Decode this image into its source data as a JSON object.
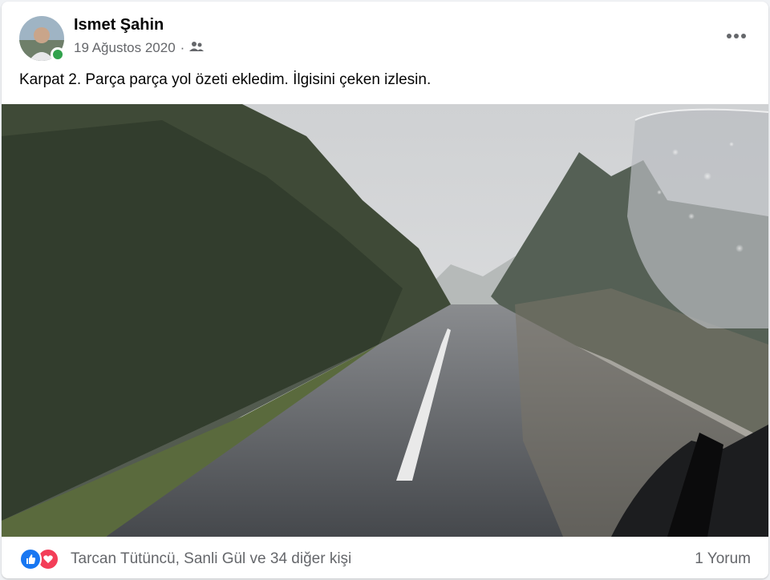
{
  "post": {
    "author": "Ismet Şahin",
    "date": "19 Ağustos 2020",
    "separator": "·",
    "audience_icon": "friends-icon",
    "caption": "Karpat 2. Parça parça yol özeti ekledim. İlgisini çeken izlesin.",
    "online": true
  },
  "reactions": {
    "icons": [
      "like-icon",
      "love-icon"
    ],
    "summary": "Tarcan Tütüncü, Sanli Gül ve 34 diğer kişi",
    "comments": "1 Yorum"
  },
  "colors": {
    "like": "#1877f2",
    "love": "#f33e58",
    "online": "#31a24c",
    "secondary_text": "#65676b"
  }
}
